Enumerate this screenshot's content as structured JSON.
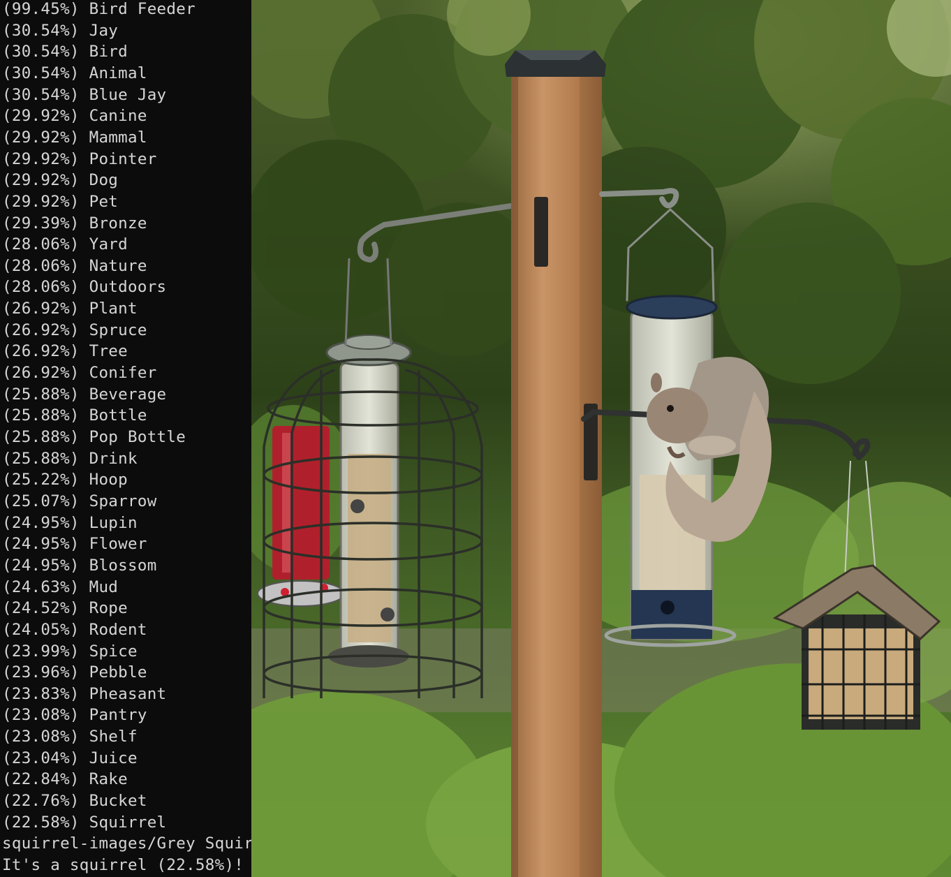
{
  "terminal": {
    "lines": [
      "(99.45%) Bird Feeder",
      "(30.54%) Jay",
      "(30.54%) Bird",
      "(30.54%) Animal",
      "(30.54%) Blue Jay",
      "(29.92%) Canine",
      "(29.92%) Mammal",
      "(29.92%) Pointer",
      "(29.92%) Dog",
      "(29.92%) Pet",
      "(29.39%) Bronze",
      "(28.06%) Yard",
      "(28.06%) Nature",
      "(28.06%) Outdoors",
      "(26.92%) Plant",
      "(26.92%) Spruce",
      "(26.92%) Tree",
      "(26.92%) Conifer",
      "(25.88%) Beverage",
      "(25.88%) Bottle",
      "(25.88%) Pop Bottle",
      "(25.88%) Drink",
      "(25.22%) Hoop",
      "(25.07%) Sparrow",
      "(24.95%) Lupin",
      "(24.95%) Flower",
      "(24.95%) Blossom",
      "(24.63%) Mud",
      "(24.52%) Rope",
      "(24.05%) Rodent",
      "(23.99%) Spice",
      "(23.96%) Pebble",
      "(23.83%) Pheasant",
      "(23.08%) Pantry",
      "(23.08%) Shelf",
      "(23.04%) Juice",
      "(22.84%) Rake",
      "(22.76%) Bucket",
      "(22.58%) Squirrel",
      "squirrel-images/Grey Squir",
      "It's a squirrel (22.58%)!"
    ]
  },
  "colors": {
    "terminal_bg": "#0c0c0c",
    "terminal_text": "#d6d6d6",
    "foliage_dark": "#2f4a1c",
    "foliage_light": "#7ea04a",
    "post_wood": "#b07a4c"
  }
}
